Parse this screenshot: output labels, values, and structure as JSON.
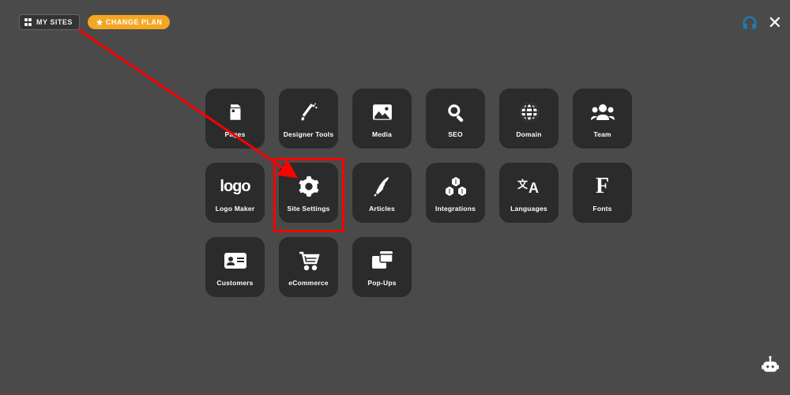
{
  "topbar": {
    "my_sites_label": "MY SITES",
    "change_plan_label": "CHANGE PLAN"
  },
  "tiles": {
    "pages": "Pages",
    "designer_tools": "Designer Tools",
    "media": "Media",
    "seo": "SEO",
    "domain": "Domain",
    "team": "Team",
    "logo_maker": "Logo Maker",
    "site_settings": "Site Settings",
    "articles": "Articles",
    "integrations": "Integrations",
    "languages": "Languages",
    "fonts": "Fonts",
    "customers": "Customers",
    "ecommerce": "eCommerce",
    "popups": "Pop-Ups"
  },
  "annotation": {
    "highlight_target": "site_settings",
    "arrow_color": "#ff0000",
    "highlight_color": "#ff0000"
  },
  "colors": {
    "background": "#4a4a4a",
    "tile_bg": "#2b2b2b",
    "accent_orange": "#f5a623",
    "accent_blue": "#1a7db8"
  },
  "icons": {
    "logo_text": "logo"
  }
}
